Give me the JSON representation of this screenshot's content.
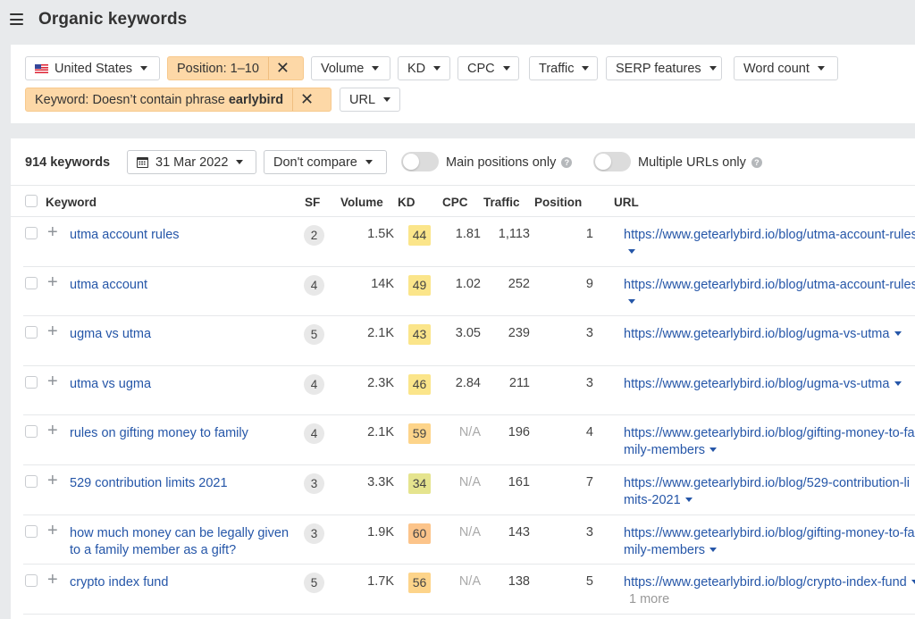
{
  "header": {
    "title": "Organic keywords",
    "menu_icon": "hamburger-menu-icon"
  },
  "filters": {
    "country": {
      "label": "United States",
      "icon": "us-flag-icon"
    },
    "position": {
      "label": "Position: 1–10",
      "active": true,
      "clear_icon": "close-icon"
    },
    "volume": {
      "label": "Volume"
    },
    "kd": {
      "label": "KD"
    },
    "cpc": {
      "label": "CPC"
    },
    "traffic": {
      "label": "Traffic"
    },
    "serp_features": {
      "label": "SERP features"
    },
    "word_count": {
      "label": "Word count"
    },
    "keyword": {
      "label_prefix": "Keyword: Doesn’t contain phrase ",
      "label_bold": "earlybird",
      "active": true,
      "clear_icon": "close-icon"
    },
    "url": {
      "label": "URL"
    }
  },
  "toolbar": {
    "keyword_count": "914 keywords",
    "date": "31 Mar 2022",
    "compare": "Don't compare",
    "main_positions_label": "Main positions only",
    "main_positions_on": false,
    "multiple_urls_label": "Multiple URLs only",
    "multiple_urls_on": false,
    "help_glyph": "?"
  },
  "colors": {
    "link": "#2556a8",
    "active_filter": "#fdd8a7",
    "kd_43_49": "#fbe58a",
    "kd_34": "#e5e48e",
    "kd_56_59": "#fdd48a",
    "kd_60": "#fcc48a"
  },
  "table": {
    "columns": [
      "Keyword",
      "SF",
      "Volume",
      "KD",
      "CPC",
      "Traffic",
      "Position",
      "URL"
    ],
    "rows": [
      {
        "keyword": "utma account rules",
        "sf": "2",
        "volume": "1.5K",
        "kd": "44",
        "kd_color": "#fbe58a",
        "cpc": "1.81",
        "traffic": "1,113",
        "position": "1",
        "url": "https://www.getearlybird.io/blog/utma-account-rules",
        "more": ""
      },
      {
        "keyword": "utma account",
        "sf": "4",
        "volume": "14K",
        "kd": "49",
        "kd_color": "#fbe58a",
        "cpc": "1.02",
        "traffic": "252",
        "position": "9",
        "url": "https://www.getearlybird.io/blog/utma-account-rules",
        "more": ""
      },
      {
        "keyword": "ugma vs utma",
        "sf": "5",
        "volume": "2.1K",
        "kd": "43",
        "kd_color": "#fbe58a",
        "cpc": "3.05",
        "traffic": "239",
        "position": "3",
        "url": "https://www.getearlybird.io/blog/ugma-vs-utma",
        "more": ""
      },
      {
        "keyword": "utma vs ugma",
        "sf": "4",
        "volume": "2.3K",
        "kd": "46",
        "kd_color": "#fbe58a",
        "cpc": "2.84",
        "traffic": "211",
        "position": "3",
        "url": "https://www.getearlybird.io/blog/ugma-vs-utma",
        "more": ""
      },
      {
        "keyword": "rules on gifting money to family",
        "sf": "4",
        "volume": "2.1K",
        "kd": "59",
        "kd_color": "#fdd48a",
        "cpc": "N/A",
        "traffic": "196",
        "position": "4",
        "url": "https://www.getearlybird.io/blog/gifting-money-to-family-members",
        "more": ""
      },
      {
        "keyword": "529 contribution limits 2021",
        "sf": "3",
        "volume": "3.3K",
        "kd": "34",
        "kd_color": "#e5e48e",
        "cpc": "N/A",
        "traffic": "161",
        "position": "7",
        "url": "https://www.getearlybird.io/blog/529-contribution-limits-2021",
        "more": ""
      },
      {
        "keyword": "how much money can be legally given to a family member as a gift?",
        "sf": "3",
        "volume": "1.9K",
        "kd": "60",
        "kd_color": "#fcc48a",
        "cpc": "N/A",
        "traffic": "143",
        "position": "3",
        "url": "https://www.getearlybird.io/blog/gifting-money-to-family-members",
        "more": ""
      },
      {
        "keyword": "crypto index fund",
        "sf": "5",
        "volume": "1.7K",
        "kd": "56",
        "kd_color": "#fdd48a",
        "cpc": "N/A",
        "traffic": "138",
        "position": "5",
        "url": "https://www.getearlybird.io/blog/crypto-index-fund",
        "more": "1 more"
      }
    ]
  }
}
